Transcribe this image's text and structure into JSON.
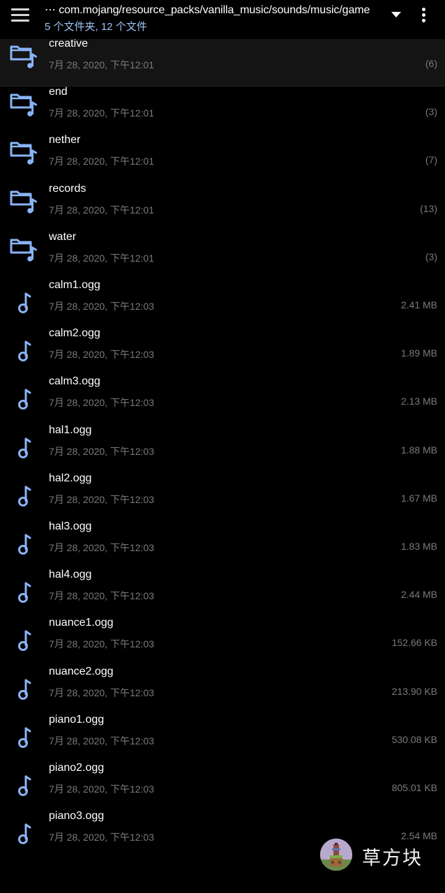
{
  "header": {
    "path": "⋯ com.mojang/resource_packs/vanilla_music/sounds/music/game",
    "subtitle": "5 个文件夹, 12 个文件"
  },
  "colors": {
    "accent_blue": "#9ec4f7",
    "icon_blue": "#8ab4f8",
    "background": "#000000",
    "secondary_text": "#7a7a7a"
  },
  "items": [
    {
      "type": "folder",
      "icon": "folder-music-icon",
      "name": "creative",
      "date": "7月 28, 2020, 下午12:01",
      "meta": "(6)"
    },
    {
      "type": "folder",
      "icon": "folder-music-icon",
      "name": "end",
      "date": "7月 28, 2020, 下午12:01",
      "meta": "(3)"
    },
    {
      "type": "folder",
      "icon": "folder-music-icon",
      "name": "nether",
      "date": "7月 28, 2020, 下午12:01",
      "meta": "(7)"
    },
    {
      "type": "folder",
      "icon": "folder-music-icon",
      "name": "records",
      "date": "7月 28, 2020, 下午12:01",
      "meta": "(13)"
    },
    {
      "type": "folder",
      "icon": "folder-music-icon",
      "name": "water",
      "date": "7月 28, 2020, 下午12:01",
      "meta": "(3)"
    },
    {
      "type": "file",
      "icon": "music-note-icon",
      "name": "calm1.ogg",
      "date": "7月 28, 2020, 下午12:03",
      "meta": "2.41 MB"
    },
    {
      "type": "file",
      "icon": "music-note-icon",
      "name": "calm2.ogg",
      "date": "7月 28, 2020, 下午12:03",
      "meta": "1.89 MB"
    },
    {
      "type": "file",
      "icon": "music-note-icon",
      "name": "calm3.ogg",
      "date": "7月 28, 2020, 下午12:03",
      "meta": "2.13 MB"
    },
    {
      "type": "file",
      "icon": "music-note-icon",
      "name": "hal1.ogg",
      "date": "7月 28, 2020, 下午12:03",
      "meta": "1.88 MB"
    },
    {
      "type": "file",
      "icon": "music-note-icon",
      "name": "hal2.ogg",
      "date": "7月 28, 2020, 下午12:03",
      "meta": "1.67 MB"
    },
    {
      "type": "file",
      "icon": "music-note-icon",
      "name": "hal3.ogg",
      "date": "7月 28, 2020, 下午12:03",
      "meta": "1.83 MB"
    },
    {
      "type": "file",
      "icon": "music-note-icon",
      "name": "hal4.ogg",
      "date": "7月 28, 2020, 下午12:03",
      "meta": "2.44 MB"
    },
    {
      "type": "file",
      "icon": "music-note-icon",
      "name": "nuance1.ogg",
      "date": "7月 28, 2020, 下午12:03",
      "meta": "152.66 KB"
    },
    {
      "type": "file",
      "icon": "music-note-icon",
      "name": "nuance2.ogg",
      "date": "7月 28, 2020, 下午12:03",
      "meta": "213.90 KB"
    },
    {
      "type": "file",
      "icon": "music-note-icon",
      "name": "piano1.ogg",
      "date": "7月 28, 2020, 下午12:03",
      "meta": "530.08 KB"
    },
    {
      "type": "file",
      "icon": "music-note-icon",
      "name": "piano2.ogg",
      "date": "7月 28, 2020, 下午12:03",
      "meta": "805.01 KB"
    },
    {
      "type": "file",
      "icon": "music-note-icon",
      "name": "piano3.ogg",
      "date": "7月 28, 2020, 下午12:03",
      "meta": "2.54 MB"
    }
  ],
  "watermark": {
    "text": "草方块"
  }
}
